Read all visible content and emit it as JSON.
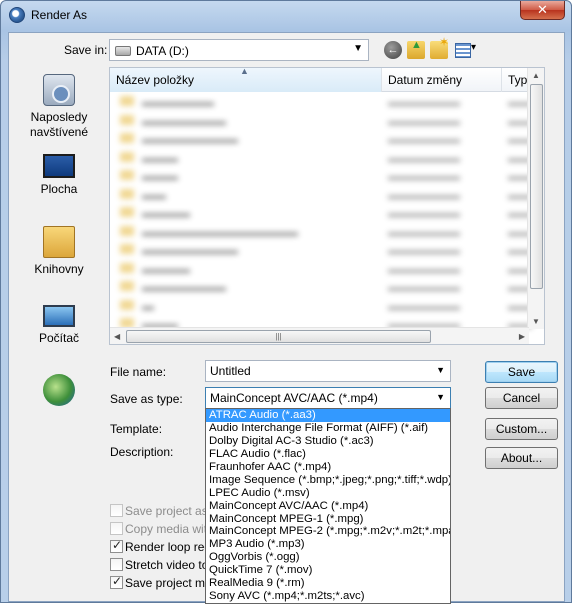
{
  "window": {
    "title": "Render As",
    "close_label": "✕"
  },
  "toolbar": {
    "save_in_label": "Save in:",
    "save_in_value": "DATA (D:)",
    "icons": [
      "back-icon",
      "up-folder-icon",
      "new-folder-icon",
      "views-menu-icon"
    ]
  },
  "places": [
    {
      "label": "Naposledy navštívené",
      "icon": "recent-places-icon"
    },
    {
      "label": "Plocha",
      "icon": "desktop-icon"
    },
    {
      "label": "Knihovny",
      "icon": "libraries-icon"
    },
    {
      "label": "Počítač",
      "icon": "computer-icon"
    },
    {
      "label": "",
      "icon": "network-icon"
    }
  ],
  "file_list": {
    "columns": [
      "Název položky",
      "Datum změny",
      "Typ"
    ]
  },
  "form": {
    "file_name_label": "File name:",
    "file_name_value": "Untitled",
    "save_as_type_label": "Save as type:",
    "save_as_type_value": "MainConcept AVC/AAC (*.mp4)",
    "template_label": "Template:",
    "description_label": "Description:"
  },
  "buttons": {
    "save": "Save",
    "cancel": "Cancel",
    "custom": "Custom...",
    "about": "About..."
  },
  "options": [
    {
      "label": "Save project as path references in rendered file",
      "checked": false,
      "enabled": false
    },
    {
      "label": "Copy media with project",
      "checked": false,
      "enabled": false
    },
    {
      "label": "Render loop region only",
      "checked": true,
      "enabled": true
    },
    {
      "label": "Stretch video to fill output frame size",
      "checked": false,
      "enabled": true
    },
    {
      "label": "Save project markers in media file",
      "checked": true,
      "enabled": true
    }
  ],
  "save_type_dropdown": {
    "selected_index": 0,
    "items": [
      "ATRAC Audio (*.aa3)",
      "Audio Interchange File Format (AIFF) (*.aif)",
      "Dolby Digital AC-3 Studio (*.ac3)",
      "FLAC Audio (*.flac)",
      "Fraunhofer AAC (*.mp4)",
      "Image Sequence (*.bmp;*.jpeg;*.png;*.tiff;*.wdp)",
      "LPEC Audio (*.msv)",
      "MainConcept AVC/AAC (*.mp4)",
      "MainConcept MPEG-1 (*.mpg)",
      "MainConcept MPEG-2 (*.mpg;*.m2v;*.m2t;*.mpa)",
      "MP3 Audio (*.mp3)",
      "OggVorbis (*.ogg)",
      "QuickTime 7 (*.mov)",
      "RealMedia 9 (*.rm)",
      "Sony AVC (*.mp4;*.m2ts;*.avc)"
    ]
  }
}
